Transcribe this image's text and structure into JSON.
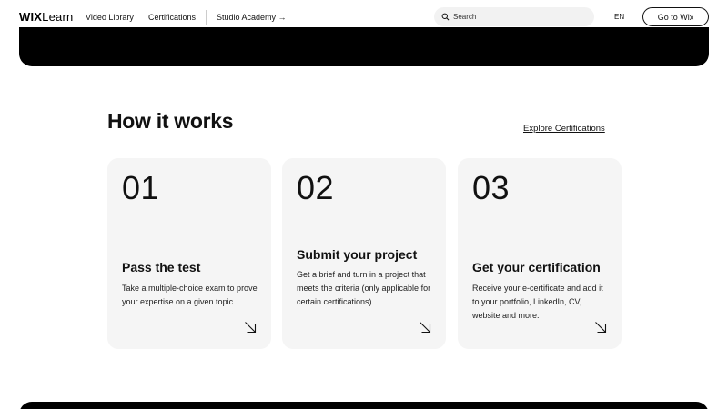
{
  "header": {
    "logo_bold": "WIX",
    "logo_light": "Learn",
    "nav": [
      "Video Library",
      "Certifications",
      "Studio Academy →"
    ],
    "search_placeholder": "Search",
    "language": "EN",
    "cta_label": "Go to Wix"
  },
  "section": {
    "title": "How it works",
    "explore_link": "Explore Certifications"
  },
  "cards": [
    {
      "number": "01",
      "title": "Pass the test",
      "description": "Take a multiple-choice exam to prove your expertise on a given topic."
    },
    {
      "number": "02",
      "title": "Submit your project",
      "description": "Get a brief and turn in a project that meets the criteria (only applicable for certain certifications)."
    },
    {
      "number": "03",
      "title": "Get your certification",
      "description": "Receive your e-certificate and add it to your portfolio, LinkedIn, CV, website and more."
    }
  ],
  "colors": {
    "banner": "#000000",
    "card_bg": "#f5f5f5",
    "search_bg": "#f2f2f2"
  }
}
